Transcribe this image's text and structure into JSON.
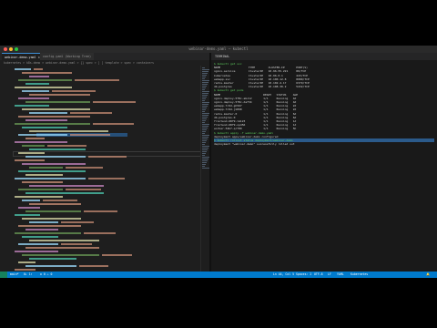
{
  "window": {
    "title": "webinar-demo.yaml — kubectl",
    "traffic_lights": [
      "#ff5f57",
      "#febc2e",
      "#28c840"
    ]
  },
  "tabs": [
    {
      "label": "webinar-demo.yaml ×",
      "active": true
    },
    {
      "label": "config.yaml  (Working Tree)",
      "active": false
    }
  ],
  "breadcrumb": "kubernetes > k8s-demo > webinar-demo.yaml > {} spec > [ ] template > spec > containers",
  "terminal": {
    "header": "TERMINAL",
    "lines": [
      "$ kubectl get svc",
      "NAME                 TYPE        CLUSTER-IP       PORT(S)",
      "nginx-service        ClusterIP   10.96.55.221     80/TCP",
      "kubernetes           ClusterIP   10.96.0.1        443/TCP",
      "webapp-svc           ClusterIP   10.100.12.8      8080/TCP",
      "redis-master         ClusterIP   10.102.4.17      6379/TCP",
      "db-postgres          ClusterIP   10.108.30.2      5432/TCP",
      "$ kubectl get pods",
      "NAME                          READY   STATUS    AGE",
      "nginx-deploy-5f8c-abc12       1/1     Running   4d",
      "nginx-deploy-5f8c-def34       1/1     Running   4d",
      "webapp-7c9d-gh567             1/1     Running   2d",
      "webapp-7c9d-jk890             1/1     Running   2d",
      "redis-master-0                1/1     Running   6d",
      "db-postgres-0                 1/1     Running   6d",
      "frontend-68f9-lm123           1/1     Running   1d",
      "frontend-68f9-np456           1/1     Running   1d",
      "worker-54b7-qr789             1/1     Running   5h",
      "$ kubectl apply -f webinar-demo.yaml",
      "deployment.apps/webinar-demo configured",
      "$ kubectl rollout status deployment/webinar-demo",
      "deployment \"webinar-demo\" successfully rolled out"
    ]
  },
  "status": {
    "branch": "main*",
    "sync": "0↓ 1↑",
    "problems": "⊗ 0  ⚠ 0",
    "position": "Ln 44, Col 5",
    "spaces": "Spaces: 2",
    "encoding": "UTF-8",
    "eol": "LF",
    "language": "YAML",
    "schema": "Kubernetes"
  }
}
